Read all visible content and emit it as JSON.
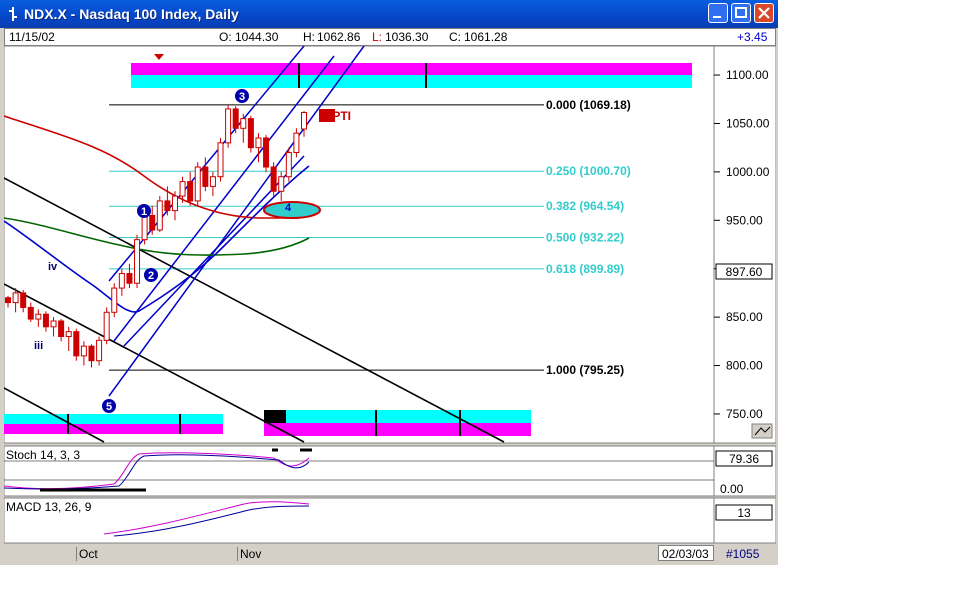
{
  "window": {
    "title": "NDX.X - Nasdaq 100 Index, Daily"
  },
  "quote": {
    "date": "11/15/02",
    "open_label": "O:",
    "open": "1044.30",
    "high_label": "H:",
    "high": "1062.86",
    "low_label": "L:",
    "low": "1036.30",
    "close_label": "C:",
    "close": "1061.28",
    "change": "+3.45"
  },
  "status": {
    "end_date": "02/03/03",
    "bar_count": "#1055",
    "months": [
      "Oct",
      "Nov"
    ]
  },
  "colors": {
    "up_candle": "#cc0000",
    "fib_line": "#33cccc",
    "sma_red": "#cc0000",
    "sma_green": "#006600",
    "sma_blue": "#0000cc",
    "magenta": "#ff00ff",
    "cyan": "#00ffff"
  },
  "chart_data": [
    {
      "type": "candlestick",
      "ylim": [
        720,
        1130
      ],
      "ticks": [
        "1100.00",
        "1050.00",
        "1000.00",
        "950.00",
        "900.00",
        "850.00",
        "800.00",
        "750.00"
      ],
      "last_price_tag": "897.60",
      "fib_levels": [
        {
          "label": "0.000 (1069.18)",
          "value": 1069.18
        },
        {
          "label": "0.250 (1000.70)",
          "value": 1000.7
        },
        {
          "label": "0.382 (964.54)",
          "value": 964.54
        },
        {
          "label": "0.500 (932.22)",
          "value": 932.22
        },
        {
          "label": "0.618 (899.89)",
          "value": 899.89
        },
        {
          "label": "1.000 (795.25)",
          "value": 795.25
        }
      ],
      "wave_labels": [
        "1",
        "2",
        "3",
        "4",
        "5",
        "iii",
        "iv"
      ],
      "annotation": "38PTI",
      "candles": [
        [
          870,
          872,
          860,
          865
        ],
        [
          865,
          880,
          855,
          875
        ],
        [
          875,
          878,
          855,
          860
        ],
        [
          860,
          865,
          845,
          848
        ],
        [
          848,
          858,
          840,
          853
        ],
        [
          853,
          856,
          835,
          840
        ],
        [
          840,
          850,
          830,
          846
        ],
        [
          846,
          848,
          825,
          830
        ],
        [
          830,
          840,
          815,
          835
        ],
        [
          835,
          838,
          805,
          810
        ],
        [
          810,
          825,
          800,
          820
        ],
        [
          820,
          822,
          798,
          805
        ],
        [
          805,
          830,
          800,
          826
        ],
        [
          826,
          860,
          822,
          855
        ],
        [
          855,
          885,
          850,
          880
        ],
        [
          880,
          900,
          872,
          895
        ],
        [
          895,
          905,
          880,
          885
        ],
        [
          885,
          935,
          880,
          930
        ],
        [
          930,
          960,
          925,
          955
        ],
        [
          955,
          965,
          935,
          940
        ],
        [
          940,
          975,
          938,
          970
        ],
        [
          970,
          985,
          955,
          960
        ],
        [
          960,
          980,
          950,
          975
        ],
        [
          975,
          995,
          968,
          990
        ],
        [
          990,
          1000,
          965,
          970
        ],
        [
          970,
          1010,
          965,
          1005
        ],
        [
          1005,
          1015,
          980,
          985
        ],
        [
          985,
          1000,
          975,
          995
        ],
        [
          995,
          1035,
          990,
          1030
        ],
        [
          1030,
          1069,
          1025,
          1065
        ],
        [
          1065,
          1068,
          1040,
          1045
        ],
        [
          1045,
          1060,
          1030,
          1055
        ],
        [
          1055,
          1058,
          1020,
          1025
        ],
        [
          1025,
          1040,
          1010,
          1035
        ],
        [
          1035,
          1038,
          1000,
          1005
        ],
        [
          1005,
          1010,
          975,
          980
        ],
        [
          980,
          1000,
          970,
          995
        ],
        [
          995,
          1025,
          990,
          1020
        ],
        [
          1020,
          1045,
          1015,
          1040
        ],
        [
          1044.3,
          1062.86,
          1036.3,
          1061.28
        ]
      ]
    },
    {
      "type": "line",
      "title": "Stoch 14, 3, 3",
      "value_tag": "79.36",
      "ticks": [
        "0.00"
      ]
    },
    {
      "type": "line",
      "title": "MACD 13, 26, 9",
      "value_tag": "13"
    }
  ]
}
